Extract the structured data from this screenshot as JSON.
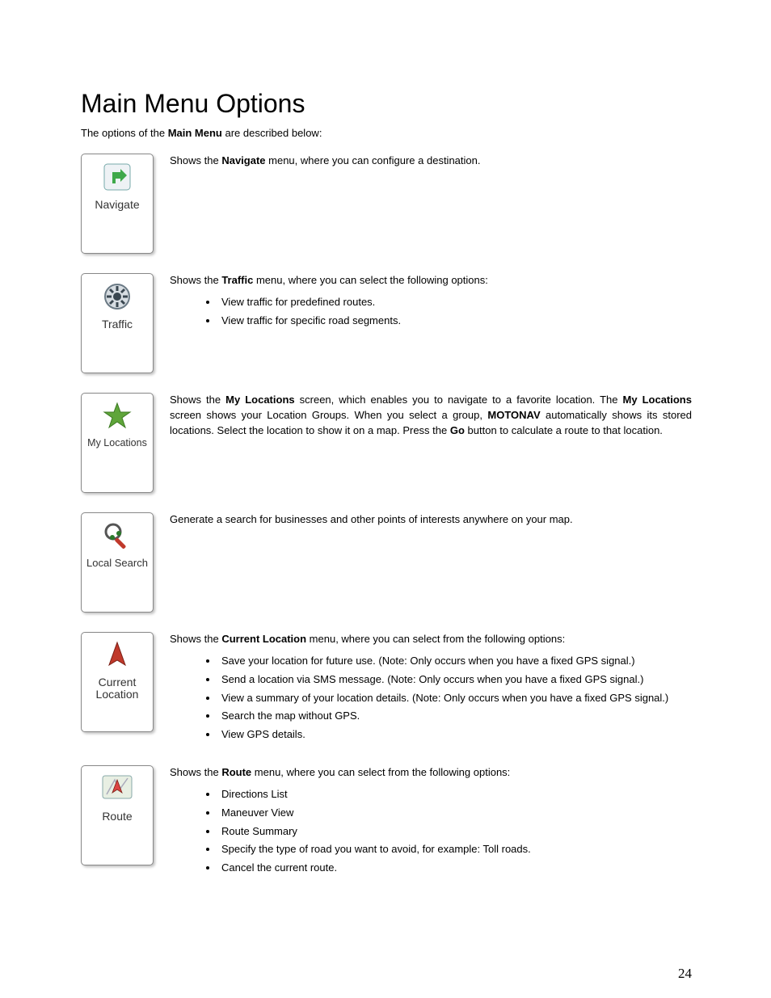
{
  "title": "Main Menu Options",
  "intro_pre": "The options of the ",
  "intro_bold": "Main Menu",
  "intro_post": " are described below:",
  "page_number": "24",
  "items": [
    {
      "icon_label": "Navigate",
      "desc_parts": [
        "Shows the ",
        "Navigate",
        " menu, where you can configure a destination."
      ],
      "bullets": []
    },
    {
      "icon_label": "Traffic",
      "desc_parts": [
        "Shows the ",
        "Traffic",
        " menu, where you can select the following options:"
      ],
      "bullets": [
        "View traffic for predefined routes.",
        "View traffic for specific road segments."
      ]
    },
    {
      "icon_label": "My Locations",
      "desc_parts_multi": [
        "Shows the ",
        "My Locations",
        " screen, which enables you to navigate to a favorite location. The ",
        "My Locations",
        " screen shows your Location Groups. When you select a group, ",
        "MOTONAV",
        " automatically shows its stored locations. Select the location to show it on a map. Press the ",
        "Go",
        " button to calculate a route to that location."
      ],
      "bullets": []
    },
    {
      "icon_label": "Local Search",
      "desc_plain": "Generate a search for businesses and other points of interests anywhere on your map.",
      "bullets": []
    },
    {
      "icon_label": "Current Location",
      "icon_label_line1": "Current",
      "icon_label_line2": "Location",
      "desc_parts": [
        "Shows the ",
        "Current Location",
        " menu, where you can select from the following options:"
      ],
      "bullets": [
        "Save your location for future use. (Note: Only occurs when you have a fixed GPS signal.)",
        "Send a location via SMS message. (Note: Only occurs when you have a fixed GPS signal.)",
        "View a summary of your location details. (Note: Only occurs when you have a fixed GPS signal.)",
        "Search the map without GPS.",
        "View GPS details."
      ]
    },
    {
      "icon_label": "Route",
      "desc_parts": [
        "Shows the ",
        "Route",
        " menu, where you can select from the following options:"
      ],
      "bullets": [
        "Directions List",
        "Maneuver View",
        "Route Summary",
        "Specify the type of road you want to avoid, for example: Toll roads.",
        "Cancel the current route."
      ]
    }
  ]
}
